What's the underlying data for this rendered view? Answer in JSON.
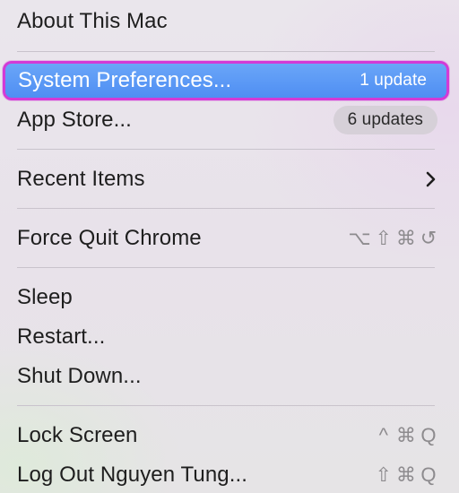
{
  "menu": {
    "about": {
      "label": "About This Mac"
    },
    "system_preferences": {
      "label": "System Preferences...",
      "badge": "1 update"
    },
    "app_store": {
      "label": "App Store...",
      "badge": "6 updates"
    },
    "recent_items": {
      "label": "Recent Items",
      "submenu_icon": "chevron-right-icon"
    },
    "force_quit": {
      "label": "Force Quit Chrome",
      "shortcut": [
        "⌥",
        "⇧",
        "⌘",
        "↺"
      ]
    },
    "sleep": {
      "label": "Sleep"
    },
    "restart": {
      "label": "Restart..."
    },
    "shut_down": {
      "label": "Shut Down..."
    },
    "lock_screen": {
      "label": "Lock Screen",
      "shortcut": [
        "^",
        "⌘",
        "Q"
      ]
    },
    "log_out": {
      "label": "Log Out Nguyen Tung...",
      "shortcut": [
        "⇧",
        "⌘",
        "Q"
      ]
    }
  },
  "colors": {
    "highlight": "#5094f4",
    "outline": "#d33ad6",
    "separator": "#c9c3cc",
    "badge_bg": "#d6d0d8"
  }
}
